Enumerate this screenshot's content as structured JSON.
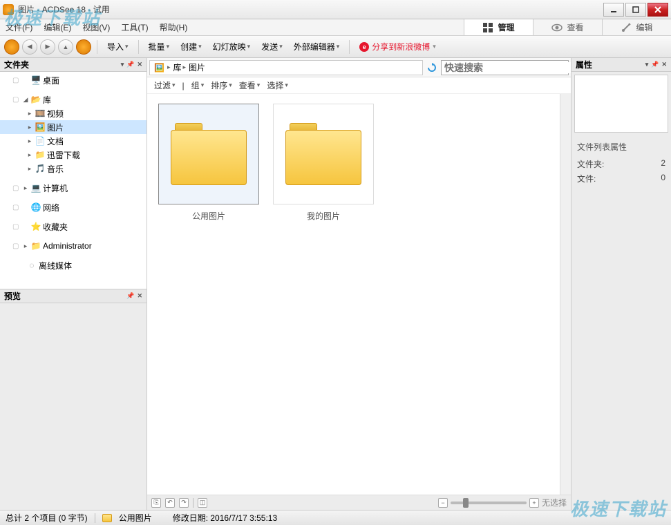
{
  "title": "图片 - ACDSee 18 - 试用",
  "watermark": "极速下载站",
  "menu": {
    "file": "文件(F)",
    "edit": "编辑(E)",
    "view": "视图(V)",
    "tools": "工具(T)",
    "help": "帮助(H)"
  },
  "modes": {
    "manage": "管理",
    "view": "查看",
    "edit": "编辑"
  },
  "toolbar": {
    "import": "导入",
    "batch": "批量",
    "create": "创建",
    "slideshow": "幻灯放映",
    "send": "发送",
    "external": "外部编辑器",
    "weibo": "分享到新浪微博"
  },
  "panes": {
    "folders": "文件夹",
    "preview": "预览",
    "properties": "属性"
  },
  "tree": {
    "desktop": "桌面",
    "library": "库",
    "video": "视频",
    "pictures": "图片",
    "documents": "文档",
    "xunlei": "迅雷下载",
    "music": "音乐",
    "computer": "计算机",
    "network": "网络",
    "favorites": "收藏夹",
    "admin": "Administrator",
    "offline": "离线媒体"
  },
  "breadcrumb": {
    "lib": "库",
    "pics": "图片"
  },
  "search": {
    "placeholder": "快速搜索"
  },
  "filters": {
    "filter": "过滤",
    "group": "组",
    "sort": "排序",
    "view": "查看",
    "select": "选择"
  },
  "thumbs": {
    "public": "公用图片",
    "my": "我的图片"
  },
  "props": {
    "section": "文件列表属性",
    "folder_label": "文件夹:",
    "folder_count": "2",
    "file_label": "文件:",
    "file_count": "0"
  },
  "bottombar": {
    "noselect": "无选择"
  },
  "status": {
    "total": "总计 2 个项目 (0 字节)",
    "selected": "公用图片",
    "modified": "修改日期: 2016/7/17 3:55:13"
  }
}
